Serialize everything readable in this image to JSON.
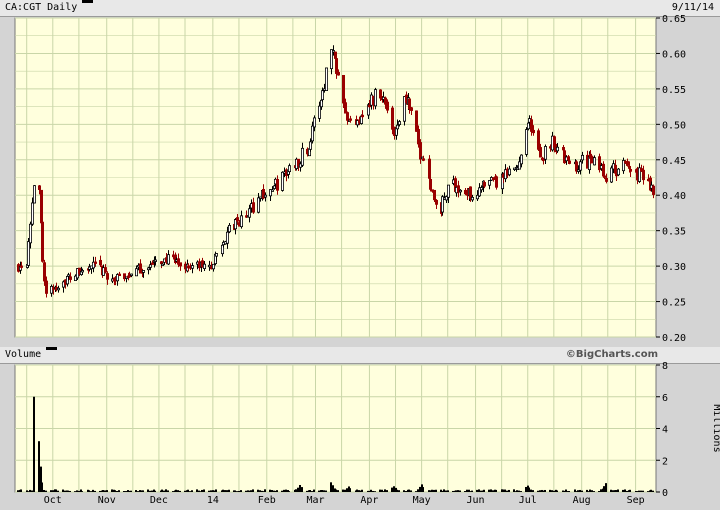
{
  "header": {
    "symbol_label": "CA:CGT Daily",
    "date_label": "9/11/14"
  },
  "volume_header": {
    "label": "Volume",
    "watermark": "©BigCharts.com"
  },
  "colors": {
    "panel_bg": "#ffffdd",
    "grid": "#c9d6a8",
    "up": "#000000",
    "down": "#990000"
  },
  "chart_data": [
    {
      "type": "bar",
      "subtype": "ohlc-price",
      "series": [
        {
          "name": "CA:CGT",
          "values": []
        }
      ],
      "x_tick_labels": [
        "Oct",
        "Nov",
        "Dec",
        "14",
        "Feb",
        "Mar",
        "Apr",
        "May",
        "Jun",
        "Jul",
        "Aug",
        "Sep"
      ],
      "y_tick_labels": [
        "0.20",
        "0.25",
        "0.30",
        "0.35",
        "0.40",
        "0.45",
        "0.50",
        "0.55",
        "0.60",
        "0.65"
      ],
      "ylim": [
        0.2,
        0.65
      ],
      "grid": true,
      "anchors": [
        [
          "2013-09-11",
          0.3
        ],
        [
          "2013-09-16",
          0.31
        ],
        [
          "2013-09-20",
          0.42
        ],
        [
          "2013-09-23",
          0.4
        ],
        [
          "2013-09-25",
          0.31
        ],
        [
          "2013-09-27",
          0.26
        ],
        [
          "2013-10-02",
          0.27
        ],
        [
          "2013-10-08",
          0.28
        ],
        [
          "2013-10-15",
          0.29
        ],
        [
          "2013-10-25",
          0.3
        ],
        [
          "2013-11-05",
          0.28
        ],
        [
          "2013-11-15",
          0.29
        ],
        [
          "2013-11-25",
          0.3
        ],
        [
          "2013-12-05",
          0.31
        ],
        [
          "2013-12-15",
          0.3
        ],
        [
          "2013-12-31",
          0.3
        ],
        [
          "2014-01-10",
          0.35
        ],
        [
          "2014-01-20",
          0.37
        ],
        [
          "2014-01-28",
          0.4
        ],
        [
          "2014-02-05",
          0.41
        ],
        [
          "2014-02-15",
          0.44
        ],
        [
          "2014-02-25",
          0.47
        ],
        [
          "2014-03-05",
          0.55
        ],
        [
          "2014-03-10",
          0.61
        ],
        [
          "2014-03-15",
          0.57
        ],
        [
          "2014-03-20",
          0.5
        ],
        [
          "2014-03-25",
          0.51
        ],
        [
          "2014-04-01",
          0.53
        ],
        [
          "2014-04-07",
          0.55
        ],
        [
          "2014-04-15",
          0.49
        ],
        [
          "2014-04-22",
          0.54
        ],
        [
          "2014-04-30",
          0.46
        ],
        [
          "2014-05-05",
          0.43
        ],
        [
          "2014-05-10",
          0.37
        ],
        [
          "2014-05-18",
          0.42
        ],
        [
          "2014-05-26",
          0.4
        ],
        [
          "2014-06-05",
          0.41
        ],
        [
          "2014-06-15",
          0.42
        ],
        [
          "2014-06-25",
          0.44
        ],
        [
          "2014-07-01",
          0.51
        ],
        [
          "2014-07-08",
          0.45
        ],
        [
          "2014-07-15",
          0.48
        ],
        [
          "2014-07-25",
          0.44
        ],
        [
          "2014-08-05",
          0.45
        ],
        [
          "2014-08-15",
          0.43
        ],
        [
          "2014-08-25",
          0.44
        ],
        [
          "2014-09-03",
          0.43
        ],
        [
          "2014-09-11",
          0.41
        ]
      ]
    },
    {
      "type": "bar",
      "subtype": "volume",
      "ylabel": "Millions",
      "y_tick_labels": [
        "0",
        "2",
        "4",
        "6",
        "8"
      ],
      "ylim": [
        0,
        8
      ],
      "grid": true,
      "spikes": [
        [
          "2013-09-20",
          6.0
        ],
        [
          "2013-09-21",
          5.9
        ],
        [
          "2013-09-23",
          3.2
        ],
        [
          "2013-09-24",
          1.6
        ],
        [
          "2013-09-25",
          0.6
        ]
      ],
      "bumps": [
        [
          "2014-02-20",
          0.4
        ],
        [
          "2014-03-10",
          0.6
        ],
        [
          "2014-03-20",
          0.3
        ],
        [
          "2014-04-15",
          0.35
        ],
        [
          "2014-05-01",
          0.45
        ],
        [
          "2014-07-01",
          0.4
        ],
        [
          "2014-08-15",
          0.55
        ]
      ]
    }
  ]
}
